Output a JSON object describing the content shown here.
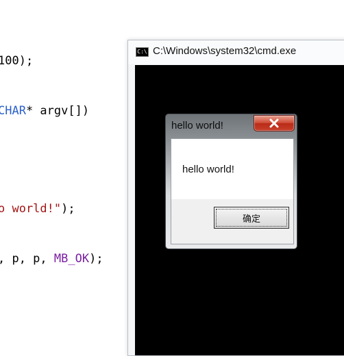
{
  "code": {
    "line1": "100);",
    "line2_type": "CHAR",
    "line2_rest": "* argv[])",
    "line3_str": "o world!\"",
    "line3_rest": ");",
    "line4_args": ", p, p, ",
    "line4_macro": "MB_OK",
    "line4_end": ");"
  },
  "cmd_window": {
    "icon_label": "C:\\",
    "title": "C:\\Windows\\system32\\cmd.exe"
  },
  "message_box": {
    "title": "hello world!",
    "message": "hello world!",
    "ok_label": "确定",
    "close_icon": "close-icon"
  }
}
